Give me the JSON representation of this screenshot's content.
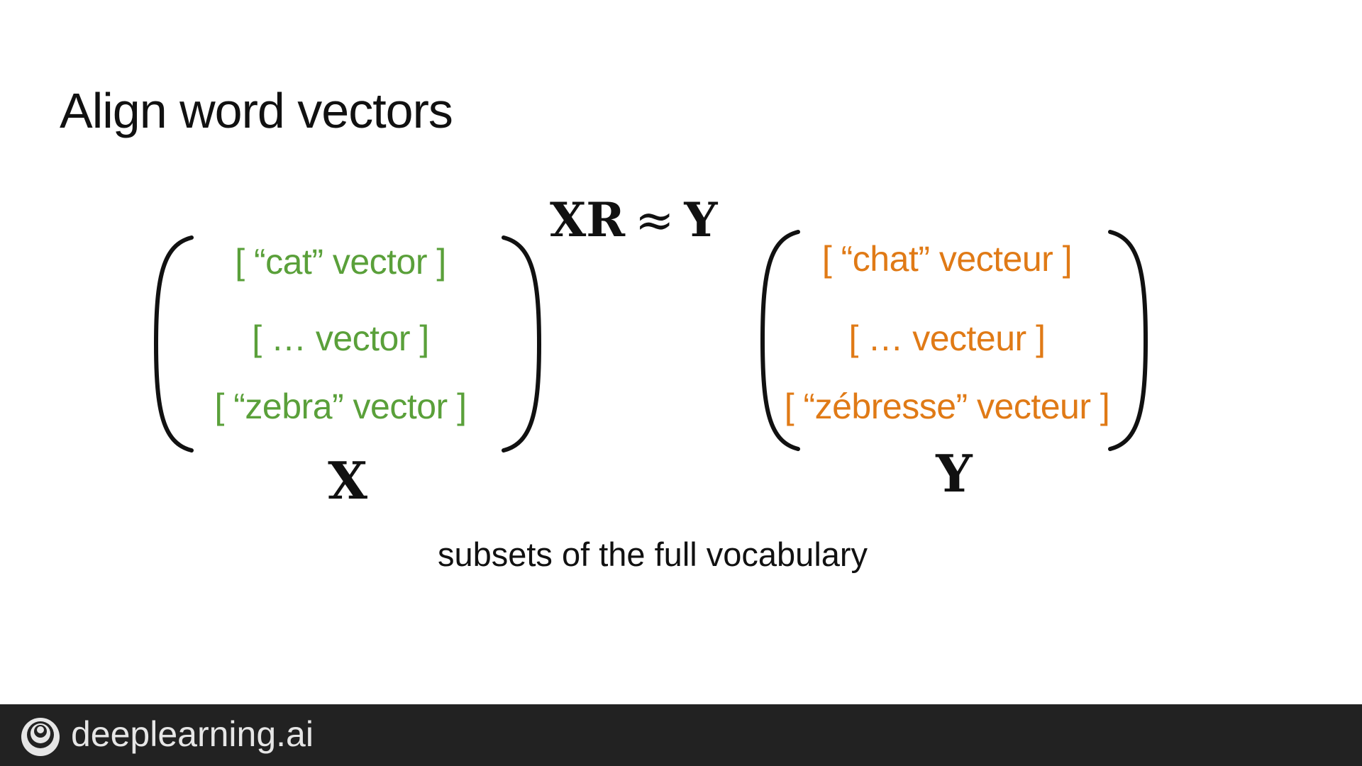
{
  "slide": {
    "title": "Align word vectors",
    "equation": {
      "lhs": "XR",
      "op": "≈",
      "rhs": "Y"
    },
    "matrix_x": {
      "rows": [
        "[ “cat” vector ]",
        "[ … vector ]",
        "[ “zebra” vector ]"
      ],
      "label": "X",
      "color": "#5aa03a"
    },
    "matrix_y": {
      "rows": [
        "[ “chat” vecteur ]",
        "[ … vecteur ]",
        "[ “zébresse” vecteur ]"
      ],
      "label": "Y",
      "color": "#e07a16"
    },
    "caption": "subsets of the full vocabulary"
  },
  "footer": {
    "brand": "deeplearning.ai",
    "logo_icon": "deeplearning-ai-logo-icon",
    "background": "#222222"
  }
}
